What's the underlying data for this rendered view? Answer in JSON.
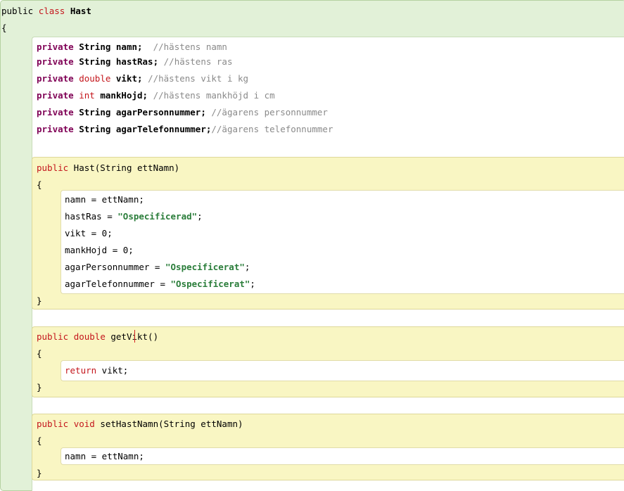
{
  "editor": {
    "class_header": {
      "kw1": "public",
      "kw2": "class",
      "name": "Hast"
    },
    "open_brace": "{",
    "close_brace": "}",
    "fields": [
      {
        "mod": "private",
        "type": "String",
        "type_kind": "ref",
        "name": "namn;",
        "comment": "  //hästens namn"
      },
      {
        "mod": "private",
        "type": "String",
        "type_kind": "ref",
        "name": "hastRas;",
        "comment": " //hästens ras"
      },
      {
        "mod": "private",
        "type": "double",
        "type_kind": "prim",
        "name": "vikt;",
        "comment": " //hästens vikt i kg"
      },
      {
        "mod": "private",
        "type": "int",
        "type_kind": "prim",
        "name": "mankHojd;",
        "comment": " //hästens mankhöjd i cm"
      },
      {
        "mod": "private",
        "type": "String",
        "type_kind": "ref",
        "name": "agarPersonnummer;",
        "comment": " //ägarens personnummer"
      },
      {
        "mod": "private",
        "type": "String",
        "type_kind": "ref",
        "name": "agarTelefonnummer;",
        "comment": "//ägarens telefonnummer"
      }
    ],
    "constructor": {
      "mod": "public",
      "rest": " Hast(String ettNamn)",
      "body": [
        {
          "code": "namn = ettNamn;"
        },
        {
          "code": "hastRas = ",
          "str": "\"Ospecificerad\"",
          "end": ";"
        },
        {
          "code": "vikt = 0;"
        },
        {
          "code": "mankHojd = 0;"
        },
        {
          "code": "agarPersonnummer = ",
          "str": "\"Ospecificerat\"",
          "end": ";"
        },
        {
          "code": "agarTelefonnummer = ",
          "str": "\"Ospecificerat\"",
          "end": ";"
        }
      ]
    },
    "method_getVikt": {
      "mod": "public",
      "type": "double",
      "rest": "getVikt()",
      "body_kw": "return",
      "body_rest": " vikt;"
    },
    "method_setHastNamn": {
      "mod": "public",
      "type": "void",
      "rest": " setHastNamn(String ettNamn)",
      "body": "namn = ettNamn;"
    }
  }
}
